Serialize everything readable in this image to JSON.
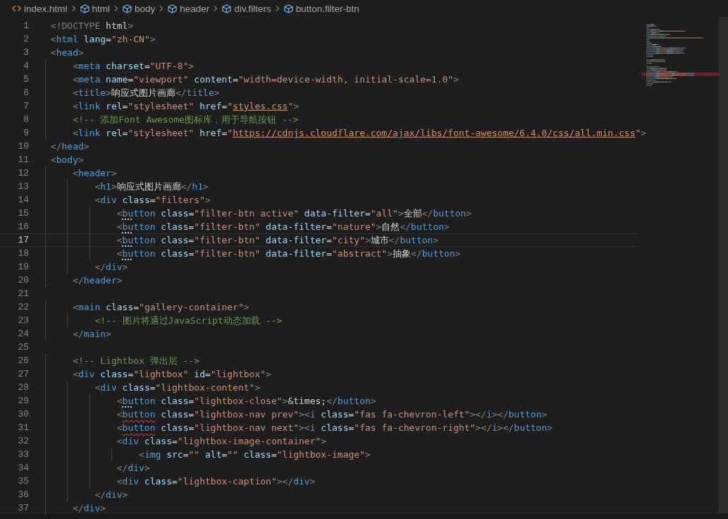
{
  "breadcrumb": [
    {
      "kind": "file",
      "label": "index.html"
    },
    {
      "kind": "element",
      "label": "html"
    },
    {
      "kind": "element",
      "label": "body"
    },
    {
      "kind": "element",
      "label": "header"
    },
    {
      "kind": "element",
      "label": "div.filters"
    },
    {
      "kind": "element",
      "label": "button.filter-btn"
    }
  ],
  "editor": {
    "lines": [
      {
        "number": "1",
        "current": false,
        "tokens": [
          {
            "kind": "punct",
            "text": "<!DOCTYPE "
          },
          {
            "kind": "text",
            "text": "html"
          },
          {
            "kind": "punct",
            "text": ">"
          }
        ]
      },
      {
        "number": "2",
        "current": false,
        "tokens": [
          {
            "kind": "punct",
            "text": "<"
          },
          {
            "kind": "tag",
            "text": "html"
          },
          {
            "kind": "attr",
            "text": " lang"
          },
          {
            "kind": "text",
            "text": "="
          },
          {
            "kind": "string",
            "text": "\"zh-CN\""
          },
          {
            "kind": "punct",
            "text": ">"
          }
        ]
      },
      {
        "number": "3",
        "current": false,
        "tokens": [
          {
            "kind": "punct",
            "text": "<"
          },
          {
            "kind": "tag",
            "text": "head"
          },
          {
            "kind": "punct",
            "text": ">"
          }
        ]
      },
      {
        "number": "4",
        "current": false,
        "tokens": [
          {
            "kind": "punct",
            "text": "    <"
          },
          {
            "kind": "tag",
            "text": "meta"
          },
          {
            "kind": "attr",
            "text": " charset"
          },
          {
            "kind": "text",
            "text": "="
          },
          {
            "kind": "string",
            "text": "\"UTF-8\""
          },
          {
            "kind": "punct",
            "text": ">"
          }
        ]
      },
      {
        "number": "5",
        "current": false,
        "tokens": [
          {
            "kind": "punct",
            "text": "    <"
          },
          {
            "kind": "tag",
            "text": "meta"
          },
          {
            "kind": "attr",
            "text": " name"
          },
          {
            "kind": "text",
            "text": "="
          },
          {
            "kind": "string",
            "text": "\"viewport\""
          },
          {
            "kind": "attr",
            "text": " content"
          },
          {
            "kind": "text",
            "text": "="
          },
          {
            "kind": "string",
            "text": "\"width=device-width, initial-scale=1.0\""
          },
          {
            "kind": "punct",
            "text": ">"
          }
        ]
      },
      {
        "number": "6",
        "current": false,
        "tokens": [
          {
            "kind": "punct",
            "text": "    <"
          },
          {
            "kind": "tag",
            "text": "title"
          },
          {
            "kind": "punct",
            "text": ">"
          },
          {
            "kind": "text",
            "text": "响应式图片画廊"
          },
          {
            "kind": "punct",
            "text": "</"
          },
          {
            "kind": "tag",
            "text": "title"
          },
          {
            "kind": "punct",
            "text": ">"
          }
        ]
      },
      {
        "number": "7",
        "current": false,
        "tokens": [
          {
            "kind": "punct",
            "text": "    <"
          },
          {
            "kind": "tag",
            "text": "link"
          },
          {
            "kind": "attr",
            "text": " rel"
          },
          {
            "kind": "text",
            "text": "="
          },
          {
            "kind": "string",
            "text": "\"stylesheet\""
          },
          {
            "kind": "attr",
            "text": " href"
          },
          {
            "kind": "text",
            "text": "="
          },
          {
            "kind": "string",
            "text": "\""
          },
          {
            "kind": "link",
            "text": "styles.css"
          },
          {
            "kind": "string",
            "text": "\""
          },
          {
            "kind": "punct",
            "text": ">"
          }
        ]
      },
      {
        "number": "8",
        "current": false,
        "tokens": [
          {
            "kind": "comment",
            "text": "    <!-- 添加Font Awesome图标库，用于导航按钮 -->"
          }
        ]
      },
      {
        "number": "9",
        "current": false,
        "tokens": [
          {
            "kind": "punct",
            "text": "    <"
          },
          {
            "kind": "tag",
            "text": "link"
          },
          {
            "kind": "attr",
            "text": " rel"
          },
          {
            "kind": "text",
            "text": "="
          },
          {
            "kind": "string",
            "text": "\"stylesheet\""
          },
          {
            "kind": "attr",
            "text": " href"
          },
          {
            "kind": "text",
            "text": "="
          },
          {
            "kind": "string",
            "text": "\""
          },
          {
            "kind": "link",
            "text": "https://cdnjs.cloudflare.com/ajax/libs/font-awesome/6.4.0/css/all.min.css"
          },
          {
            "kind": "string",
            "text": "\""
          },
          {
            "kind": "punct",
            "text": ">"
          }
        ]
      },
      {
        "number": "10",
        "current": false,
        "tokens": [
          {
            "kind": "punct",
            "text": "</"
          },
          {
            "kind": "tag",
            "text": "head"
          },
          {
            "kind": "punct",
            "text": ">"
          }
        ]
      },
      {
        "number": "11",
        "current": false,
        "tokens": [
          {
            "kind": "punct",
            "text": "<"
          },
          {
            "kind": "tag",
            "text": "body"
          },
          {
            "kind": "punct",
            "text": ">"
          }
        ]
      },
      {
        "number": "12",
        "current": false,
        "tokens": [
          {
            "kind": "punct",
            "text": "    <"
          },
          {
            "kind": "tag",
            "text": "header"
          },
          {
            "kind": "punct",
            "text": ">"
          }
        ]
      },
      {
        "number": "13",
        "current": false,
        "tokens": [
          {
            "kind": "punct",
            "text": "        <"
          },
          {
            "kind": "tag",
            "text": "h1"
          },
          {
            "kind": "punct",
            "text": ">"
          },
          {
            "kind": "text",
            "text": "响应式图片画廊"
          },
          {
            "kind": "punct",
            "text": "</"
          },
          {
            "kind": "tag",
            "text": "h1"
          },
          {
            "kind": "punct",
            "text": ">"
          }
        ]
      },
      {
        "number": "14",
        "current": false,
        "tokens": [
          {
            "kind": "punct",
            "text": "        <"
          },
          {
            "kind": "tag",
            "text": "div"
          },
          {
            "kind": "attr",
            "text": " class"
          },
          {
            "kind": "text",
            "text": "="
          },
          {
            "kind": "string",
            "text": "\"filters\""
          },
          {
            "kind": "punct",
            "text": ">"
          }
        ]
      },
      {
        "number": "15",
        "current": false,
        "tokens": [
          {
            "kind": "punct",
            "text": "            <"
          },
          {
            "kind": "hinted-tag",
            "text": "bu"
          },
          {
            "kind": "tag",
            "text": "tton"
          },
          {
            "kind": "attr",
            "text": " class"
          },
          {
            "kind": "text",
            "text": "="
          },
          {
            "kind": "string",
            "text": "\"filter-btn active\""
          },
          {
            "kind": "attr",
            "text": " data-filter"
          },
          {
            "kind": "text",
            "text": "="
          },
          {
            "kind": "string",
            "text": "\"all\""
          },
          {
            "kind": "punct",
            "text": ">"
          },
          {
            "kind": "text",
            "text": "全部"
          },
          {
            "kind": "punct",
            "text": "</"
          },
          {
            "kind": "tag",
            "text": "button"
          },
          {
            "kind": "punct",
            "text": ">"
          }
        ]
      },
      {
        "number": "16",
        "current": false,
        "tokens": [
          {
            "kind": "punct",
            "text": "            <"
          },
          {
            "kind": "hinted-tag",
            "text": "bu"
          },
          {
            "kind": "tag",
            "text": "tton"
          },
          {
            "kind": "attr",
            "text": " class"
          },
          {
            "kind": "text",
            "text": "="
          },
          {
            "kind": "string",
            "text": "\"filter-btn\""
          },
          {
            "kind": "attr",
            "text": " data-filter"
          },
          {
            "kind": "text",
            "text": "="
          },
          {
            "kind": "string",
            "text": "\"nature\""
          },
          {
            "kind": "punct",
            "text": ">"
          },
          {
            "kind": "text",
            "text": "自然"
          },
          {
            "kind": "punct",
            "text": "</"
          },
          {
            "kind": "tag",
            "text": "button"
          },
          {
            "kind": "punct",
            "text": ">"
          }
        ]
      },
      {
        "number": "17",
        "current": true,
        "tokens": [
          {
            "kind": "punct",
            "text": "            <"
          },
          {
            "kind": "hinted-tag",
            "text": "bu"
          },
          {
            "kind": "tag",
            "text": "tton"
          },
          {
            "kind": "attr",
            "text": " class"
          },
          {
            "kind": "text",
            "text": "="
          },
          {
            "kind": "string",
            "text": "\"filter-btn\""
          },
          {
            "kind": "attr",
            "text": " data-filter"
          },
          {
            "kind": "text",
            "text": "="
          },
          {
            "kind": "string",
            "text": "\"city\""
          },
          {
            "kind": "punct",
            "text": ">"
          },
          {
            "kind": "text",
            "text": "城市"
          },
          {
            "kind": "punct",
            "text": "</"
          },
          {
            "kind": "tag",
            "text": "button"
          },
          {
            "kind": "punct",
            "text": ">"
          }
        ]
      },
      {
        "number": "18",
        "current": false,
        "tokens": [
          {
            "kind": "punct",
            "text": "            <"
          },
          {
            "kind": "hinted-tag",
            "text": "bu"
          },
          {
            "kind": "tag",
            "text": "tton"
          },
          {
            "kind": "attr",
            "text": " class"
          },
          {
            "kind": "text",
            "text": "="
          },
          {
            "kind": "string",
            "text": "\"filter-btn\""
          },
          {
            "kind": "attr",
            "text": " data-filter"
          },
          {
            "kind": "text",
            "text": "="
          },
          {
            "kind": "string",
            "text": "\"abstract\""
          },
          {
            "kind": "punct",
            "text": ">"
          },
          {
            "kind": "text",
            "text": "抽象"
          },
          {
            "kind": "punct",
            "text": "</"
          },
          {
            "kind": "tag",
            "text": "button"
          },
          {
            "kind": "punct",
            "text": ">"
          }
        ]
      },
      {
        "number": "19",
        "current": false,
        "tokens": [
          {
            "kind": "punct",
            "text": "        </"
          },
          {
            "kind": "tag",
            "text": "div"
          },
          {
            "kind": "punct",
            "text": ">"
          }
        ]
      },
      {
        "number": "20",
        "current": false,
        "tokens": [
          {
            "kind": "punct",
            "text": "    </"
          },
          {
            "kind": "tag",
            "text": "header"
          },
          {
            "kind": "punct",
            "text": ">"
          }
        ]
      },
      {
        "number": "21",
        "current": false
      },
      {
        "number": "22",
        "current": false,
        "tokens": [
          {
            "kind": "punct",
            "text": "    <"
          },
          {
            "kind": "tag",
            "text": "main"
          },
          {
            "kind": "attr",
            "text": " class"
          },
          {
            "kind": "text",
            "text": "="
          },
          {
            "kind": "string",
            "text": "\"gallery-container\""
          },
          {
            "kind": "punct",
            "text": ">"
          }
        ]
      },
      {
        "number": "23",
        "current": false,
        "tokens": [
          {
            "kind": "comment",
            "text": "        <!-- 图片将通过JavaScript动态加载 -->"
          }
        ]
      },
      {
        "number": "24",
        "current": false,
        "tokens": [
          {
            "kind": "punct",
            "text": "    </"
          },
          {
            "kind": "tag",
            "text": "main"
          },
          {
            "kind": "punct",
            "text": ">"
          }
        ]
      },
      {
        "number": "25",
        "current": false
      },
      {
        "number": "26",
        "current": false,
        "tokens": [
          {
            "kind": "comment",
            "text": "    <!-- Lightbox 弹出层 -->"
          }
        ]
      },
      {
        "number": "27",
        "current": false,
        "tokens": [
          {
            "kind": "punct",
            "text": "    <"
          },
          {
            "kind": "tag",
            "text": "div"
          },
          {
            "kind": "attr",
            "text": " class"
          },
          {
            "kind": "text",
            "text": "="
          },
          {
            "kind": "string",
            "text": "\"lightbox\""
          },
          {
            "kind": "attr",
            "text": " id"
          },
          {
            "kind": "text",
            "text": "="
          },
          {
            "kind": "string",
            "text": "\"lightbox\""
          },
          {
            "kind": "punct",
            "text": ">"
          }
        ]
      },
      {
        "number": "28",
        "current": false,
        "tokens": [
          {
            "kind": "punct",
            "text": "        <"
          },
          {
            "kind": "tag",
            "text": "div"
          },
          {
            "kind": "attr",
            "text": " class"
          },
          {
            "kind": "text",
            "text": "="
          },
          {
            "kind": "string",
            "text": "\"lightbox-content\""
          },
          {
            "kind": "punct",
            "text": ">"
          }
        ]
      },
      {
        "number": "29",
        "current": false,
        "tokens": [
          {
            "kind": "punct",
            "text": "            <"
          },
          {
            "kind": "hinted-tag",
            "text": "bu"
          },
          {
            "kind": "tag",
            "text": "tton"
          },
          {
            "kind": "attr",
            "text": " class"
          },
          {
            "kind": "text",
            "text": "="
          },
          {
            "kind": "string",
            "text": "\"lightbox-close\""
          },
          {
            "kind": "punct",
            "text": ">"
          },
          {
            "kind": "text",
            "text": "&times;"
          },
          {
            "kind": "punct",
            "text": "</"
          },
          {
            "kind": "tag",
            "text": "button"
          },
          {
            "kind": "punct",
            "text": ">"
          }
        ]
      },
      {
        "number": "30",
        "current": false,
        "tokens": [
          {
            "kind": "punct",
            "text": "            <"
          },
          {
            "kind": "error-tag",
            "text": "button"
          },
          {
            "kind": "attr",
            "text": " class"
          },
          {
            "kind": "text",
            "text": "="
          },
          {
            "kind": "string",
            "text": "\"lightbox-nav prev\""
          },
          {
            "kind": "punct",
            "text": "><"
          },
          {
            "kind": "tag",
            "text": "i"
          },
          {
            "kind": "attr",
            "text": " class"
          },
          {
            "kind": "text",
            "text": "="
          },
          {
            "kind": "string",
            "text": "\"fas fa-chevron-left\""
          },
          {
            "kind": "punct",
            "text": "></"
          },
          {
            "kind": "tag",
            "text": "i"
          },
          {
            "kind": "punct",
            "text": "></"
          },
          {
            "kind": "tag",
            "text": "button"
          },
          {
            "kind": "punct",
            "text": ">"
          }
        ]
      },
      {
        "number": "31",
        "current": false,
        "tokens": [
          {
            "kind": "punct",
            "text": "            <"
          },
          {
            "kind": "error-tag",
            "text": "button"
          },
          {
            "kind": "attr",
            "text": " class"
          },
          {
            "kind": "text",
            "text": "="
          },
          {
            "kind": "string",
            "text": "\"lightbox-nav next\""
          },
          {
            "kind": "punct",
            "text": "><"
          },
          {
            "kind": "tag",
            "text": "i"
          },
          {
            "kind": "attr",
            "text": " class"
          },
          {
            "kind": "text",
            "text": "="
          },
          {
            "kind": "string",
            "text": "\"fas fa-chevron-right\""
          },
          {
            "kind": "punct",
            "text": "></"
          },
          {
            "kind": "tag",
            "text": "i"
          },
          {
            "kind": "punct",
            "text": "></"
          },
          {
            "kind": "tag",
            "text": "button"
          },
          {
            "kind": "punct",
            "text": ">"
          }
        ]
      },
      {
        "number": "32",
        "current": false,
        "tokens": [
          {
            "kind": "punct",
            "text": "            <"
          },
          {
            "kind": "tag",
            "text": "div"
          },
          {
            "kind": "attr",
            "text": " class"
          },
          {
            "kind": "text",
            "text": "="
          },
          {
            "kind": "string",
            "text": "\"lightbox-image-container\""
          },
          {
            "kind": "punct",
            "text": ">"
          }
        ]
      },
      {
        "number": "33",
        "current": false,
        "tokens": [
          {
            "kind": "punct",
            "text": "                <"
          },
          {
            "kind": "tag",
            "text": "img"
          },
          {
            "kind": "attr",
            "text": " src"
          },
          {
            "kind": "text",
            "text": "="
          },
          {
            "kind": "string",
            "text": "\"\""
          },
          {
            "kind": "attr",
            "text": " alt"
          },
          {
            "kind": "text",
            "text": "="
          },
          {
            "kind": "string",
            "text": "\"\""
          },
          {
            "kind": "attr",
            "text": " class"
          },
          {
            "kind": "text",
            "text": "="
          },
          {
            "kind": "string",
            "text": "\"lightbox-image\""
          },
          {
            "kind": "punct",
            "text": ">"
          }
        ]
      },
      {
        "number": "34",
        "current": false,
        "tokens": [
          {
            "kind": "punct",
            "text": "            </"
          },
          {
            "kind": "tag",
            "text": "div"
          },
          {
            "kind": "punct",
            "text": ">"
          }
        ]
      },
      {
        "number": "35",
        "current": false,
        "tokens": [
          {
            "kind": "punct",
            "text": "            <"
          },
          {
            "kind": "tag",
            "text": "div"
          },
          {
            "kind": "attr",
            "text": " class"
          },
          {
            "kind": "text",
            "text": "="
          },
          {
            "kind": "string",
            "text": "\"lightbox-caption\""
          },
          {
            "kind": "punct",
            "text": "></"
          },
          {
            "kind": "tag",
            "text": "div"
          },
          {
            "kind": "punct",
            "text": ">"
          }
        ]
      },
      {
        "number": "36",
        "current": false,
        "tokens": [
          {
            "kind": "punct",
            "text": "        </"
          },
          {
            "kind": "tag",
            "text": "div"
          },
          {
            "kind": "punct",
            "text": ">"
          }
        ]
      },
      {
        "number": "37",
        "current": false,
        "tokens": [
          {
            "kind": "punct",
            "text": "    </"
          },
          {
            "kind": "tag",
            "text": "div"
          },
          {
            "kind": "punct",
            "text": ">"
          }
        ]
      }
    ]
  }
}
